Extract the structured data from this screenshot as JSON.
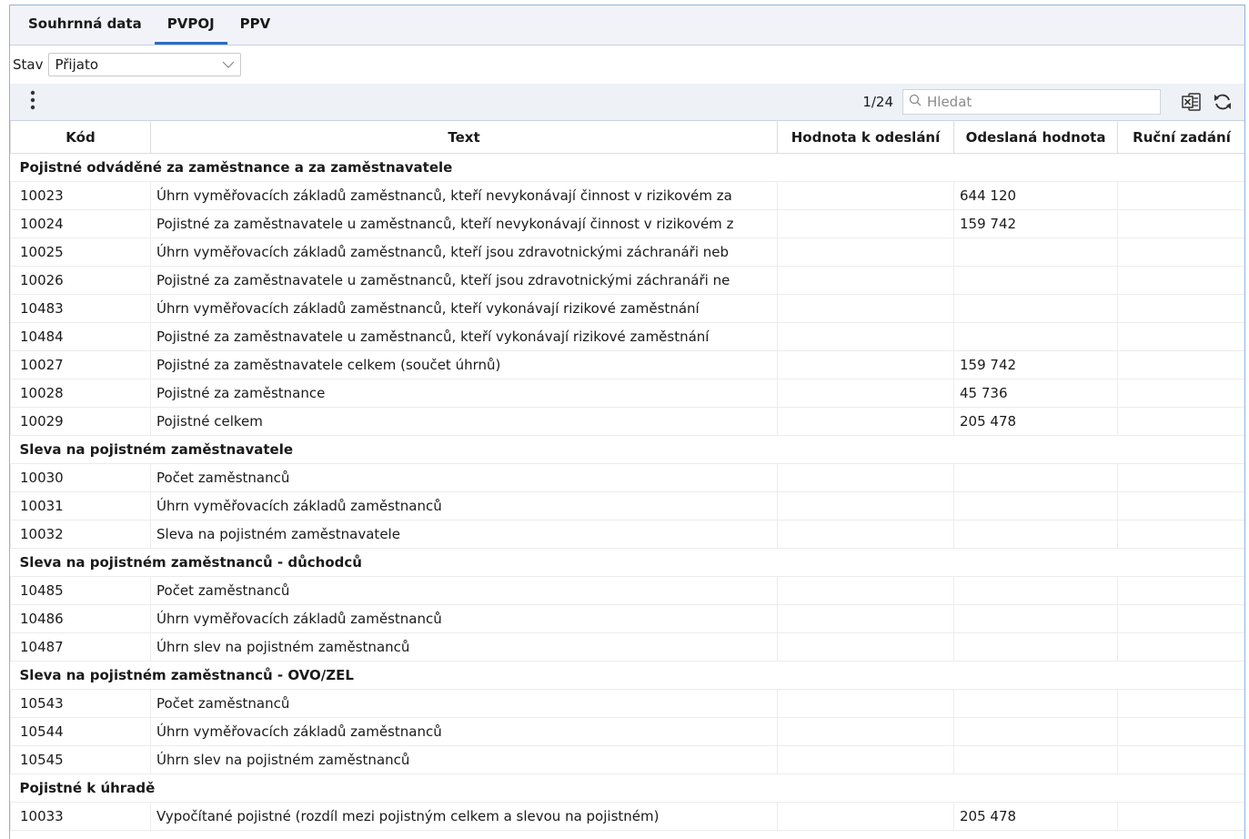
{
  "tabs": [
    {
      "label": "Souhrnná data",
      "active": false
    },
    {
      "label": "PVPOJ",
      "active": true
    },
    {
      "label": "PPV",
      "active": false
    }
  ],
  "filter": {
    "label": "Stav",
    "value": "Přijato"
  },
  "toolbar": {
    "pager": "1/24",
    "search_placeholder": "Hledat"
  },
  "columns": [
    "Kód",
    "Text",
    "Hodnota k odeslání",
    "Odeslaná hodnota",
    "Ruční zadání"
  ],
  "rows": [
    {
      "type": "group",
      "label": "Pojistné odváděné za zaměstnance a za zaměstnavatele"
    },
    {
      "type": "data",
      "code": "10023",
      "text": "Úhrn vyměřovacích základů zaměstnanců, kteří nevykonávají činnost v rizikovém za",
      "hodnota": "",
      "odeslana": "644 120",
      "rucni": ""
    },
    {
      "type": "data",
      "code": "10024",
      "text": "Pojistné za zaměstnavatele u zaměstnanců, kteří nevykonávají činnost v rizikovém z",
      "hodnota": "",
      "odeslana": "159 742",
      "rucni": ""
    },
    {
      "type": "data",
      "code": "10025",
      "text": "Úhrn vyměřovacích základů zaměstnanců, kteří jsou zdravotnickými záchranáři neb",
      "hodnota": "",
      "odeslana": "",
      "rucni": ""
    },
    {
      "type": "data",
      "code": "10026",
      "text": "Pojistné za zaměstnavatele u zaměstnanců, kteří jsou zdravotnickými záchranáři ne",
      "hodnota": "",
      "odeslana": "",
      "rucni": ""
    },
    {
      "type": "data",
      "code": "10483",
      "text": "Úhrn vyměřovacích základů zaměstnanců, kteří vykonávají rizikové zaměstnání",
      "hodnota": "",
      "odeslana": "",
      "rucni": ""
    },
    {
      "type": "data",
      "code": "10484",
      "text": "Pojistné za zaměstnavatele u zaměstnanců, kteří vykonávají rizikové zaměstnání",
      "hodnota": "",
      "odeslana": "",
      "rucni": ""
    },
    {
      "type": "data",
      "code": "10027",
      "text": "Pojistné za zaměstnavatele celkem (součet úhrnů)",
      "hodnota": "",
      "odeslana": "159 742",
      "rucni": ""
    },
    {
      "type": "data",
      "code": "10028",
      "text": "Pojistné za zaměstnance",
      "hodnota": "",
      "odeslana": "45 736",
      "rucni": ""
    },
    {
      "type": "data",
      "code": "10029",
      "text": "Pojistné celkem",
      "hodnota": "",
      "odeslana": "205 478",
      "rucni": ""
    },
    {
      "type": "group",
      "label": "Sleva na pojistném zaměstnavatele"
    },
    {
      "type": "data",
      "code": "10030",
      "text": "Počet zaměstnanců",
      "hodnota": "",
      "odeslana": "",
      "rucni": ""
    },
    {
      "type": "data",
      "code": "10031",
      "text": "Úhrn vyměřovacích základů zaměstnanců",
      "hodnota": "",
      "odeslana": "",
      "rucni": ""
    },
    {
      "type": "data",
      "code": "10032",
      "text": "Sleva na pojistném zaměstnavatele",
      "hodnota": "",
      "odeslana": "",
      "rucni": ""
    },
    {
      "type": "group",
      "label": "Sleva na pojistném zaměstnanců - důchodců"
    },
    {
      "type": "data",
      "code": "10485",
      "text": "Počet zaměstnanců",
      "hodnota": "",
      "odeslana": "",
      "rucni": ""
    },
    {
      "type": "data",
      "code": "10486",
      "text": "Úhrn vyměřovacích základů zaměstnanců",
      "hodnota": "",
      "odeslana": "",
      "rucni": ""
    },
    {
      "type": "data",
      "code": "10487",
      "text": "Úhrn slev na pojistném zaměstnanců",
      "hodnota": "",
      "odeslana": "",
      "rucni": ""
    },
    {
      "type": "group",
      "label": "Sleva na pojistném zaměstnanců - OVO/ZEL"
    },
    {
      "type": "data",
      "code": "10543",
      "text": "Počet zaměstnanců",
      "hodnota": "",
      "odeslana": "",
      "rucni": ""
    },
    {
      "type": "data",
      "code": "10544",
      "text": "Úhrn vyměřovacích základů zaměstnanců",
      "hodnota": "",
      "odeslana": "",
      "rucni": ""
    },
    {
      "type": "data",
      "code": "10545",
      "text": "Úhrn slev na pojistném zaměstnanců",
      "hodnota": "",
      "odeslana": "",
      "rucni": ""
    },
    {
      "type": "group",
      "label": "Pojistné k úhradě"
    },
    {
      "type": "data",
      "code": "10033",
      "text": "Vypočítané pojistné (rozdíl mezi pojistným celkem a slevou na pojistném)",
      "hodnota": "",
      "odeslana": "205 478",
      "rucni": ""
    }
  ],
  "icons": {
    "more": "more-vertical-icon",
    "search": "search-icon",
    "export": "excel-export-icon",
    "refresh": "refresh-icon"
  },
  "colors": {
    "accent": "#2a6cc4",
    "toolbar_bg": "#eef1f6",
    "frame_border": "#8fb3d9"
  }
}
